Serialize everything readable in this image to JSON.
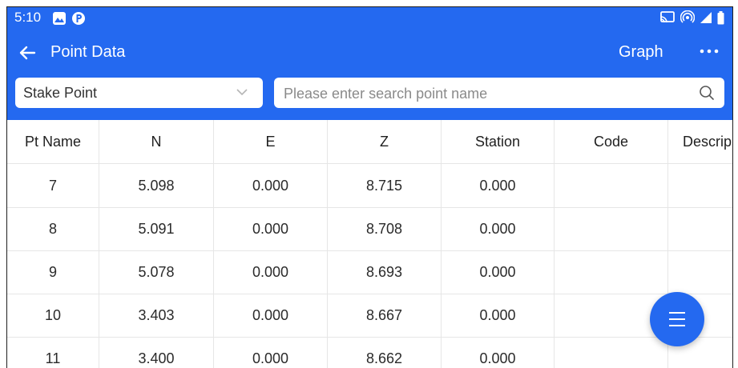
{
  "status_bar": {
    "time": "5:10"
  },
  "header": {
    "title": "Point Data",
    "graph_label": "Graph"
  },
  "filter": {
    "selected": "Stake Point",
    "search_placeholder": "Please enter search point name"
  },
  "table": {
    "columns": [
      "Pt Name",
      "N",
      "E",
      "Z",
      "Station",
      "Code",
      "Descrip"
    ],
    "rows": [
      [
        "7",
        "5.098",
        "0.000",
        "8.715",
        "0.000",
        "",
        ""
      ],
      [
        "8",
        "5.091",
        "0.000",
        "8.708",
        "0.000",
        "",
        ""
      ],
      [
        "9",
        "5.078",
        "0.000",
        "8.693",
        "0.000",
        "",
        ""
      ],
      [
        "10",
        "3.403",
        "0.000",
        "8.667",
        "0.000",
        "",
        ""
      ],
      [
        "11",
        "3.400",
        "0.000",
        "8.662",
        "0.000",
        "",
        ""
      ]
    ]
  },
  "colors": {
    "primary": "#2469f0",
    "header_text": "#ffffff",
    "grid": "#e6e6e6"
  },
  "icons": {
    "back": "arrow-left-icon",
    "more": "more-horizontal-icon",
    "search": "search-icon",
    "dropdown": "chevron-down-icon",
    "fab": "menu-icon"
  }
}
